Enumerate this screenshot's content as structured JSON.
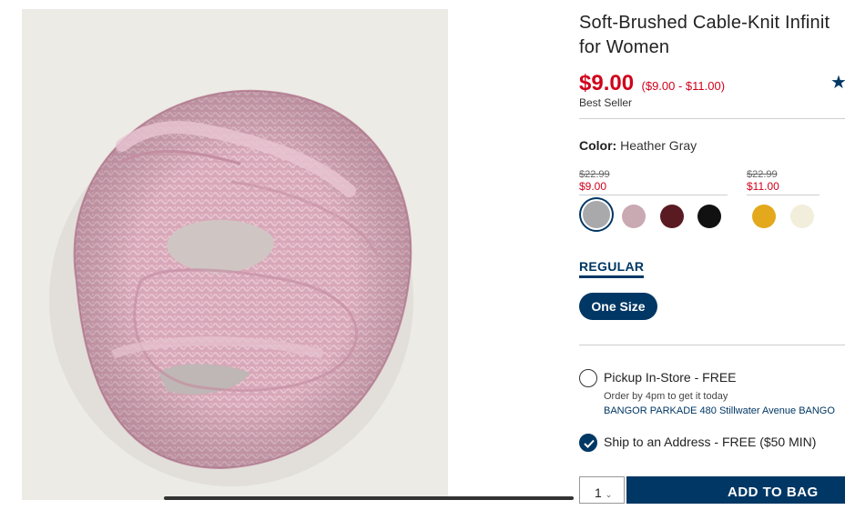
{
  "product": {
    "title_line1": "Soft-Brushed Cable-Knit Infinit",
    "title_line2": "for Women",
    "price": "$9.00",
    "price_range": "($9.00 - $11.00)",
    "badge": "Best Seller",
    "rating_star": "★"
  },
  "color": {
    "label": "Color:",
    "value": "Heather Gray",
    "groups": [
      {
        "was": "$22.99",
        "now": "$9.00"
      },
      {
        "was": "$22.99",
        "now": "$11.00"
      }
    ],
    "swatches": [
      {
        "name": "heather-gray",
        "hex": "#a9a9ab",
        "selected": true
      },
      {
        "name": "pink-heather",
        "hex": "#c9a9b2",
        "selected": false
      },
      {
        "name": "burgundy",
        "hex": "#5a1a22",
        "selected": false
      },
      {
        "name": "black",
        "hex": "#111111",
        "selected": false
      },
      {
        "name": "mustard",
        "hex": "#e3a81b",
        "selected": false
      },
      {
        "name": "cream",
        "hex": "#f2eedc",
        "selected": false
      }
    ]
  },
  "fit": {
    "tab": "REGULAR"
  },
  "size": {
    "selected": "One Size"
  },
  "fulfillment": {
    "pickup_label": "Pickup In-Store - FREE",
    "pickup_sub": "Order by 4pm to get it today",
    "pickup_store": "BANGOR PARKADE 480 Stillwater Avenue  BANGO",
    "ship_label": "Ship to an Address - FREE ($50 MIN)",
    "ship_checked": true
  },
  "cart": {
    "qty": "1",
    "add_label": "ADD TO BAG"
  }
}
